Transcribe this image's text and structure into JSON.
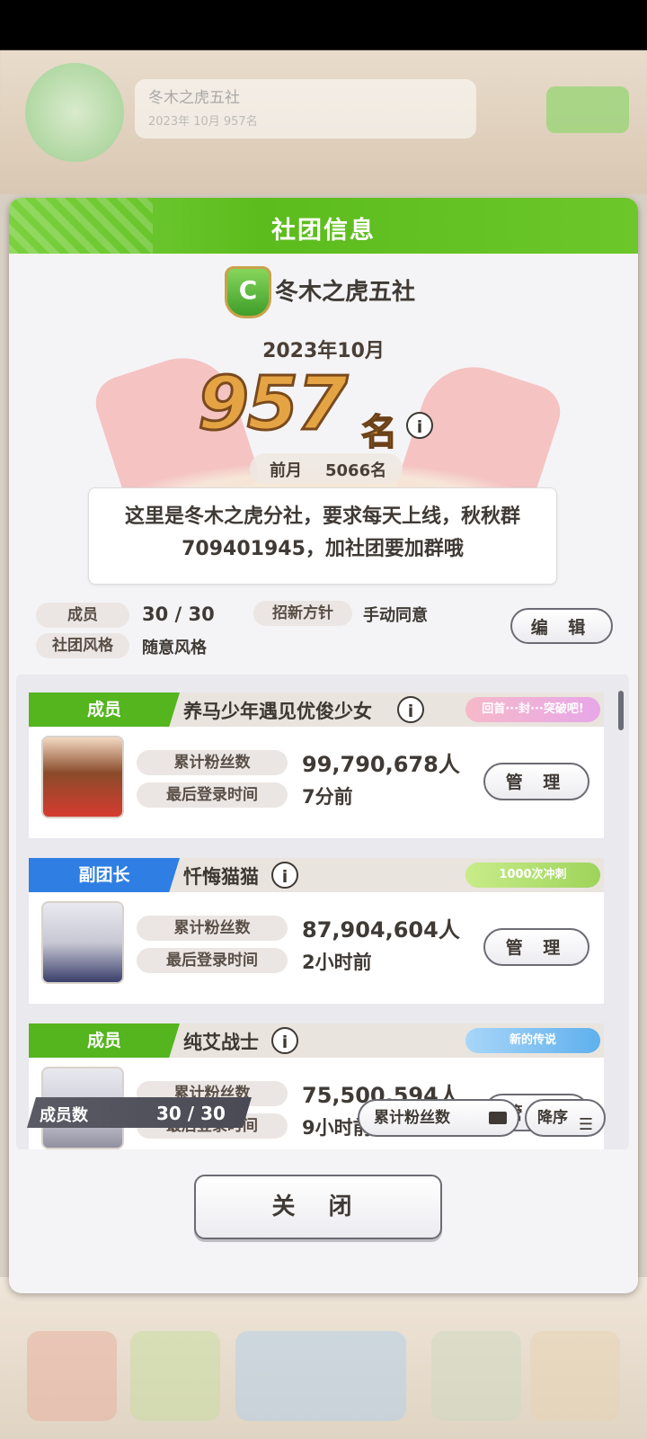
{
  "background": {
    "club_name": "冬木之虎五社",
    "subtitle": "2023年 10月 957名"
  },
  "dialog": {
    "title": "社团信息",
    "club_name": "冬木之虎五社",
    "rank_date": "2023年10月",
    "rank_number": "957",
    "rank_unit": "名",
    "prev_label": "前月",
    "prev_rank": "5066名",
    "description": "这里是冬木之虎分社，要求每天上线，秋秋群709401945，加社团要加群哦",
    "members_label": "成员",
    "members_value": "30 / 30",
    "recruit_label": "招新方针",
    "recruit_value": "手动同意",
    "style_label": "社团风格",
    "style_value": "随意风格",
    "edit_button": "编 辑",
    "close_button": "关 闭"
  },
  "members": [
    {
      "role": "成员",
      "name": "养马少年遇见优俊少女",
      "badge": "回首···封···突破吧!",
      "fans_label": "累计粉丝数",
      "fans": "99,790,678人",
      "login_label": "最后登录时间",
      "login": "7分前",
      "manage": "管 理"
    },
    {
      "role": "副团长",
      "name": "忏悔猫猫",
      "badge": "1000次冲刺",
      "fans_label": "累计粉丝数",
      "fans": "87,904,604人",
      "login_label": "最后登录时间",
      "login": "2小时前",
      "manage": "管 理"
    },
    {
      "role": "成员",
      "name": "纯艾战士",
      "badge": "新的传说",
      "fans_label": "累计粉丝数",
      "fans": "75,500,594人",
      "login_label": "最后登录时间",
      "login": "9小时前",
      "manage": "管 理"
    }
  ],
  "footer": {
    "count_label": "成员数",
    "count_value": "30 / 30",
    "sort_field": "累计粉丝数",
    "sort_order": "降序"
  },
  "colors": {
    "header_green": "#5cbc1d",
    "role_green": "#54b51e",
    "role_blue": "#2e7ee3",
    "rank_gold": "#e5a443"
  }
}
